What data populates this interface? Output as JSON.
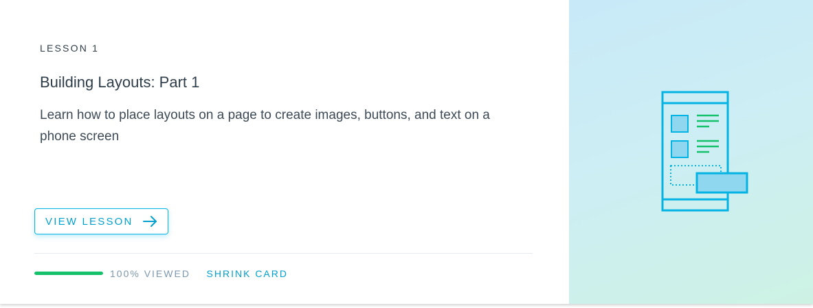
{
  "lesson": {
    "eyebrow": "LESSON 1",
    "title": "Building Layouts: Part 1",
    "description": "Learn how to place layouts on a page to create images, buttons, and text on a phone screen"
  },
  "actions": {
    "view_label": "VIEW LESSON",
    "shrink_label": "SHRINK CARD"
  },
  "progress": {
    "fraction": 1.0,
    "text": "100% VIEWED"
  },
  "colors": {
    "accent": "#02b3e4",
    "progress": "#15c26b",
    "illustration_green": "#15c26b",
    "illustration_blue": "#02b3e4"
  },
  "icons": {
    "arrow": "arrow-right-icon",
    "illustration": "phone-layout-illustration"
  }
}
